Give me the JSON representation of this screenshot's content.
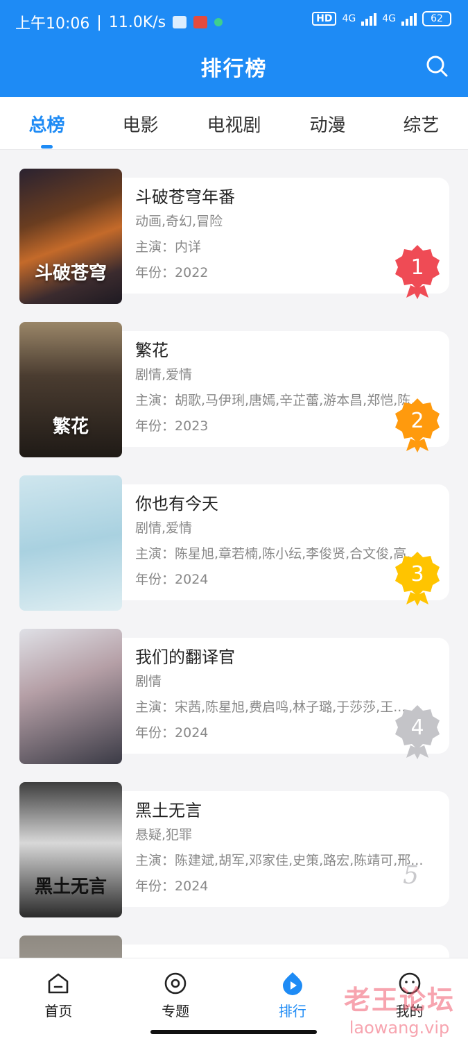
{
  "status_bar": {
    "time": "上午10:06",
    "speed": "11.0K/s",
    "hd": "HD",
    "network_1": "4G",
    "network_2": "4G",
    "battery": "62"
  },
  "header": {
    "title": "排行榜",
    "search_icon": "search-icon"
  },
  "tabs": [
    {
      "label": "总榜",
      "active": true
    },
    {
      "label": "电影",
      "active": false
    },
    {
      "label": "电视剧",
      "active": false
    },
    {
      "label": "动漫",
      "active": false
    },
    {
      "label": "综艺",
      "active": false
    }
  ],
  "list": {
    "items": [
      {
        "rank": "1",
        "title": "斗破苍穹年番",
        "genres": "动画,奇幻,冒险",
        "cast_label": "主演：",
        "cast": "内详",
        "year_label": "年份：",
        "year": "2022",
        "poster_text": "斗破苍穹",
        "badge_color": "#ef4b55"
      },
      {
        "rank": "2",
        "title": "繁花",
        "genres": "剧情,爱情",
        "cast_label": "主演：",
        "cast": "胡歌,马伊琍,唐嫣,辛芷蕾,游本昌,郑恺,陈...",
        "year_label": "年份：",
        "year": "2023",
        "poster_text": "繁花",
        "badge_color": "#ff9a0d"
      },
      {
        "rank": "3",
        "title": "你也有今天",
        "genres": "剧情,爱情",
        "cast_label": "主演：",
        "cast": "陈星旭,章若楠,陈小纭,李俊贤,合文俊,高...",
        "year_label": "年份：",
        "year": "2024",
        "poster_text": "",
        "badge_color": "#ffc400"
      },
      {
        "rank": "4",
        "title": "我们的翻译官",
        "genres": "剧情",
        "cast_label": "主演：",
        "cast": "宋茜,陈星旭,费启鸣,林子璐,于莎莎,王...",
        "year_label": "年份：",
        "year": "2024",
        "poster_text": "",
        "badge_color": "#c4c4c8"
      },
      {
        "rank": "5",
        "title": "黑土无言",
        "genres": "悬疑,犯罪",
        "cast_label": "主演：",
        "cast": "陈建斌,胡军,邓家佳,史策,路宏,陈靖可,邢...",
        "year_label": "年份：",
        "year": "2024",
        "poster_text": "黑土无言",
        "badge_color": ""
      }
    ]
  },
  "bottom_nav": [
    {
      "label": "首页",
      "icon": "home-icon",
      "active": false
    },
    {
      "label": "专题",
      "icon": "topic-icon",
      "active": false
    },
    {
      "label": "排行",
      "icon": "ranking-icon",
      "active": true
    },
    {
      "label": "我的",
      "icon": "profile-icon",
      "active": false
    }
  ],
  "watermark": {
    "text": "老王论坛",
    "url": "laowang.vip"
  },
  "colors": {
    "primary": "#1e8bf5",
    "rank_1": "#ef4b55",
    "rank_2": "#ff9a0d",
    "rank_3": "#ffc400",
    "rank_4": "#c4c4c8"
  }
}
